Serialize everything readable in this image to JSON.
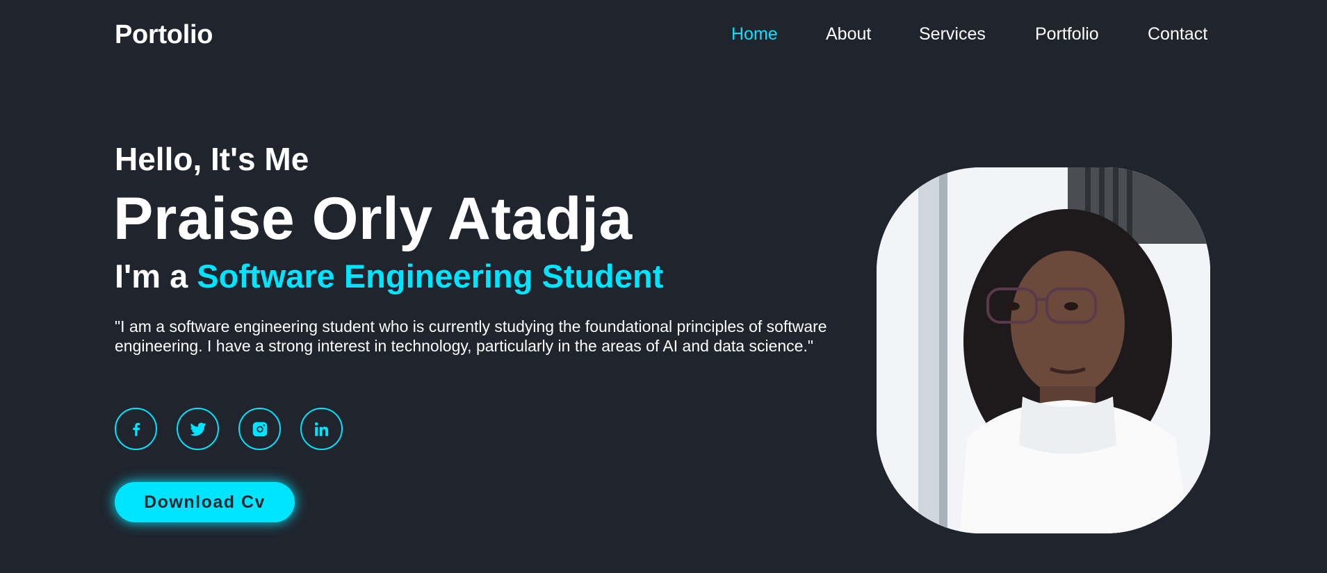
{
  "header": {
    "logo": "Portolio",
    "nav": [
      {
        "label": "Home",
        "active": true
      },
      {
        "label": "About",
        "active": false
      },
      {
        "label": "Services",
        "active": false
      },
      {
        "label": "Portfolio",
        "active": false
      },
      {
        "label": "Contact",
        "active": false
      }
    ]
  },
  "hero": {
    "greeting": "Hello, It's Me",
    "name": "Praise Orly Atadja",
    "role_prefix": "I'm a ",
    "role_highlight": "Software Engineering Student",
    "bio": "\"I am a software engineering student who is currently studying the foundational principles of software engineering. I have a strong interest in technology, particularly in the areas of AI and data science.\"",
    "socials": [
      {
        "icon": "facebook-icon"
      },
      {
        "icon": "twitter-icon"
      },
      {
        "icon": "instagram-icon"
      },
      {
        "icon": "linkedin-icon"
      }
    ],
    "cta_label": "Download Cv",
    "photo": {
      "icon": "profile-photo"
    }
  },
  "colors": {
    "background": "#1f242d",
    "accent": "#00e5ff",
    "text": "#ffffff"
  }
}
